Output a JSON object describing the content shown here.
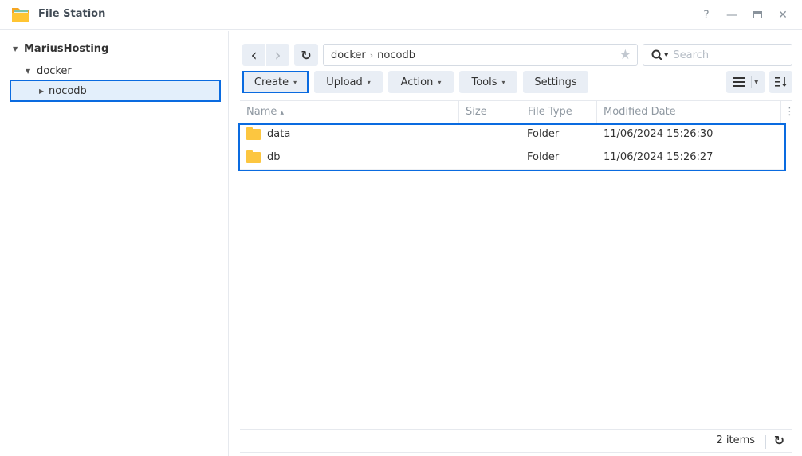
{
  "window": {
    "title": "File Station",
    "controls": {
      "help": "?",
      "minimize": "—",
      "maximize": "▭",
      "close": "✕"
    }
  },
  "sidebar": {
    "root": {
      "label": "MariusHosting",
      "expanded": true
    },
    "items": [
      {
        "label": "docker",
        "expanded": true
      },
      {
        "label": "nocodb",
        "expanded": false,
        "selected": true
      }
    ]
  },
  "toolbar": {
    "back": "‹",
    "forward": "›",
    "refresh": "↻",
    "path": [
      "docker",
      "nocodb"
    ],
    "path_separator": "›",
    "favorite_icon": "★",
    "search_placeholder": "Search",
    "buttons": {
      "create": "Create",
      "upload": "Upload",
      "action": "Action",
      "tools": "Tools",
      "settings": "Settings"
    },
    "dropdown_caret": "▾"
  },
  "table": {
    "columns": [
      "Name",
      "Size",
      "File Type",
      "Modified Date"
    ],
    "sort_indicator": "▴",
    "rows": [
      {
        "name": "data",
        "size": "",
        "type": "Folder",
        "modified": "11/06/2024 15:26:30"
      },
      {
        "name": "db",
        "size": "",
        "type": "Folder",
        "modified": "11/06/2024 15:26:27"
      }
    ]
  },
  "footer": {
    "count": "2 items",
    "refresh": "↻"
  },
  "colors": {
    "accent": "#0a6be0",
    "selection_bg": "#e3effb",
    "button_bg": "#e9eef5",
    "folder": "#fcc640"
  }
}
